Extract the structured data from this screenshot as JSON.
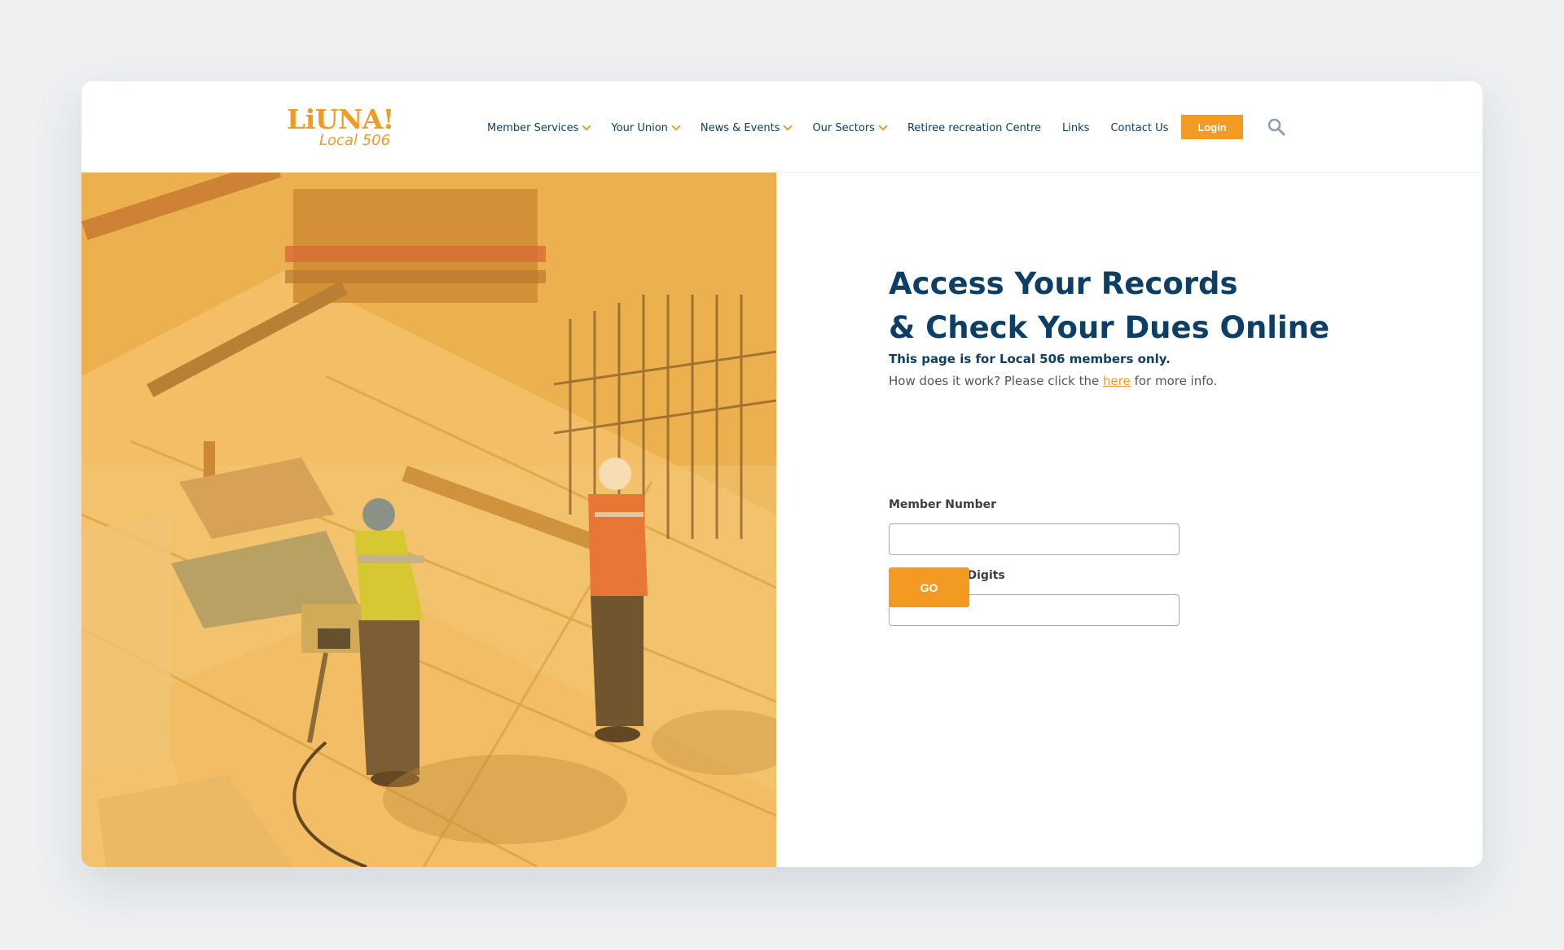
{
  "brand": {
    "name": "LiUNA!",
    "sub": "Local 506",
    "accent": "#f39a22",
    "navy": "#0d3e66"
  },
  "nav": {
    "items": [
      {
        "label": "Member Services",
        "dropdown": true
      },
      {
        "label": "Your Union",
        "dropdown": true
      },
      {
        "label": "News & Events",
        "dropdown": true
      },
      {
        "label": "Our Sectors",
        "dropdown": true
      },
      {
        "label": "Retiree recreation Centre",
        "dropdown": false
      },
      {
        "label": "Links",
        "dropdown": false
      },
      {
        "label": "Contact Us",
        "dropdown": false
      }
    ],
    "login_label": "Login",
    "search_icon": "search-icon"
  },
  "main": {
    "title_line1": "Access Your Records",
    "title_line2": "& Check Your Dues Online",
    "notice": "This page is for Local 506 members only.",
    "info_before": "How does it work? Please click the",
    "info_link": "here",
    "info_after": "for more info.",
    "form": {
      "member_label": "Member Number",
      "member_value": "",
      "sin_label": "SIN# Last 4 Digits",
      "sin_value": "",
      "go_label": "GO"
    }
  }
}
